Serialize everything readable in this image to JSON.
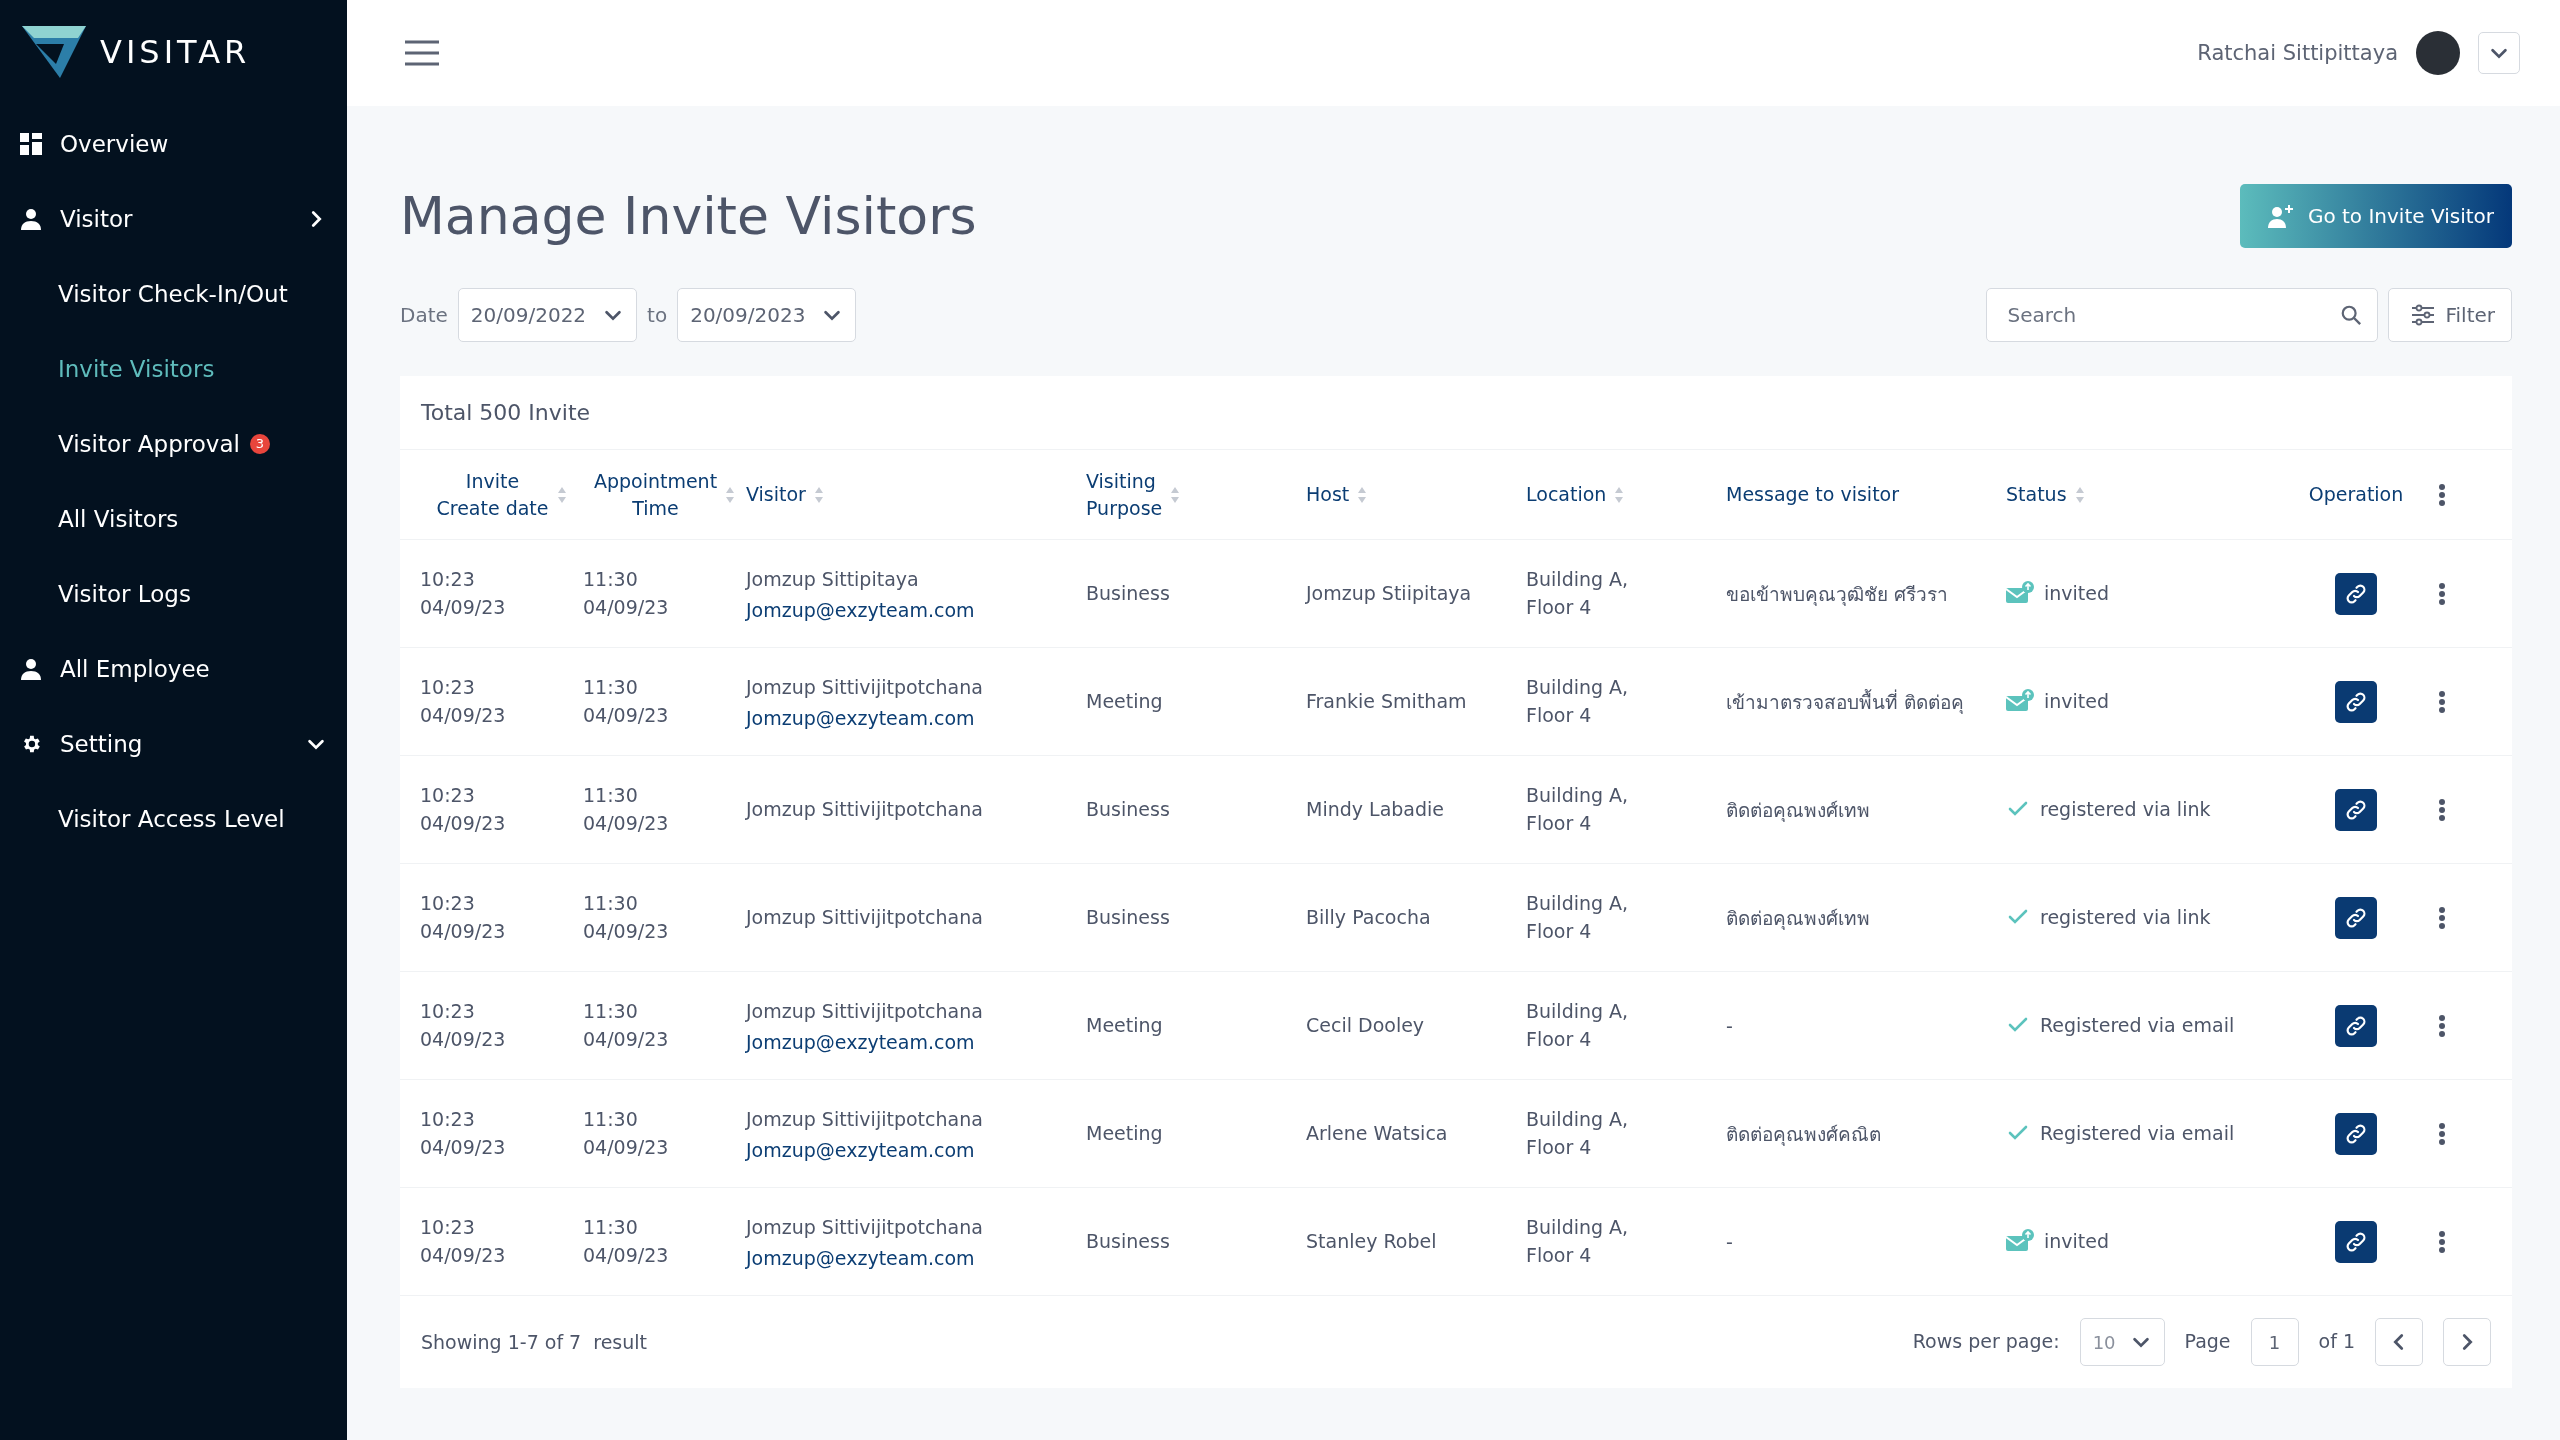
{
  "brand": {
    "name": "VISITAR"
  },
  "sidebar": {
    "items": [
      {
        "label": "Overview",
        "selected": false
      },
      {
        "label": "Visitor",
        "expanded": false,
        "selected": false,
        "children": [
          {
            "label": "Visitor Check-In/Out",
            "selected": false
          },
          {
            "label": "Invite Visitors",
            "selected": true
          },
          {
            "label": "Visitor Approval",
            "badge": "3",
            "selected": false
          },
          {
            "label": "All Visitors",
            "selected": false
          },
          {
            "label": "Visitor Logs",
            "selected": false
          }
        ]
      },
      {
        "label": "All Employee",
        "selected": false
      },
      {
        "label": "Setting",
        "expanded": true,
        "selected": false,
        "children": [
          {
            "label": "Visitor Access Level",
            "selected": false
          }
        ]
      }
    ]
  },
  "header": {
    "user": "Ratchai Sittipittaya"
  },
  "page": {
    "title": "Manage Invite Visitors",
    "primary_button": "Go to Invite Visitor"
  },
  "filters": {
    "date_label": "Date",
    "from": "20/09/2022",
    "to_label": "to",
    "to": "20/09/2023",
    "search": {
      "placeholder": "Search"
    },
    "filter_button": "Filter"
  },
  "table": {
    "total": "Total 500 Invite",
    "columns": [
      {
        "label": "Invite\nCreate date",
        "sortable": true
      },
      {
        "label": "Appointment\nTime",
        "sortable": true
      },
      {
        "label": "Visitor",
        "sortable": true
      },
      {
        "label": "Visiting\nPurpose",
        "sortable": true
      },
      {
        "label": "Host",
        "sortable": true
      },
      {
        "label": "Location",
        "sortable": true
      },
      {
        "label": "Message to visitor",
        "sortable": false
      },
      {
        "label": "Status",
        "sortable": true
      },
      {
        "label": "Operation",
        "sortable": false
      }
    ],
    "rows": [
      {
        "created": [
          "10:23",
          "04/09/23"
        ],
        "appointment": [
          "11:30",
          "04/09/23"
        ],
        "visitor": "Jomzup Sittipitaya",
        "email": "Jomzup@exzyteam.com",
        "purpose": "Business",
        "host": "Jomzup Stiipitaya",
        "location": [
          "Building A,",
          "Floor 4"
        ],
        "message": "ขอเข้าพบคุณวุฒิชัย ศรีวรา",
        "status": {
          "kind": "invited",
          "label": "invited"
        }
      },
      {
        "created": [
          "10:23",
          "04/09/23"
        ],
        "appointment": [
          "11:30",
          "04/09/23"
        ],
        "visitor": "Jomzup Sittivijitpotchana",
        "email": "Jomzup@exzyteam.com",
        "purpose": "Meeting",
        "host": "Frankie Smitham",
        "location": [
          "Building A,",
          "Floor 4"
        ],
        "message": "เข้ามาตรวจสอบพื้นที่ ติดต่อคุ",
        "status": {
          "kind": "invited",
          "label": "invited"
        }
      },
      {
        "created": [
          "10:23",
          "04/09/23"
        ],
        "appointment": [
          "11:30",
          "04/09/23"
        ],
        "visitor": "Jomzup Sittivijitpotchana",
        "purpose": "Business",
        "host": "Mindy Labadie",
        "location": [
          "Building A,",
          "Floor 4"
        ],
        "message": "ติดต่อคุณพงศ์เทพ",
        "status": {
          "kind": "registered",
          "label": "registered via link"
        }
      },
      {
        "created": [
          "10:23",
          "04/09/23"
        ],
        "appointment": [
          "11:30",
          "04/09/23"
        ],
        "visitor": "Jomzup Sittivijitpotchana",
        "purpose": "Business",
        "host": "Billy Pacocha",
        "location": [
          "Building A,",
          "Floor 4"
        ],
        "message": "ติดต่อคุณพงศ์เทพ",
        "status": {
          "kind": "registered",
          "label": "registered via link"
        }
      },
      {
        "created": [
          "10:23",
          "04/09/23"
        ],
        "appointment": [
          "11:30",
          "04/09/23"
        ],
        "visitor": "Jomzup Sittivijitpotchana",
        "email": "Jomzup@exzyteam.com",
        "purpose": "Meeting",
        "host": "Cecil Dooley",
        "location": [
          "Building A,",
          "Floor 4"
        ],
        "message": "-",
        "status": {
          "kind": "registered",
          "label": "Registered via email"
        }
      },
      {
        "created": [
          "10:23",
          "04/09/23"
        ],
        "appointment": [
          "11:30",
          "04/09/23"
        ],
        "visitor": "Jomzup Sittivijitpotchana",
        "email": "Jomzup@exzyteam.com",
        "purpose": "Meeting",
        "host": "Arlene Watsica",
        "location": [
          "Building A,",
          "Floor 4"
        ],
        "message": "ติดต่อคุณพงศ์คณิต",
        "status": {
          "kind": "registered",
          "label": "Registered via email"
        }
      },
      {
        "created": [
          "10:23",
          "04/09/23"
        ],
        "appointment": [
          "11:30",
          "04/09/23"
        ],
        "visitor": "Jomzup Sittivijitpotchana",
        "email": "Jomzup@exzyteam.com",
        "purpose": "Business",
        "host": "Stanley Robel",
        "location": [
          "Building A,",
          "Floor 4"
        ],
        "message": "-",
        "status": {
          "kind": "invited",
          "label": "invited"
        }
      }
    ]
  },
  "pagination": {
    "showing": "Showing 1-7 of 7  result",
    "rows_label": "Rows per page:",
    "rows_value": "10",
    "page_label": "Page",
    "page": "1",
    "of": "of 1"
  }
}
